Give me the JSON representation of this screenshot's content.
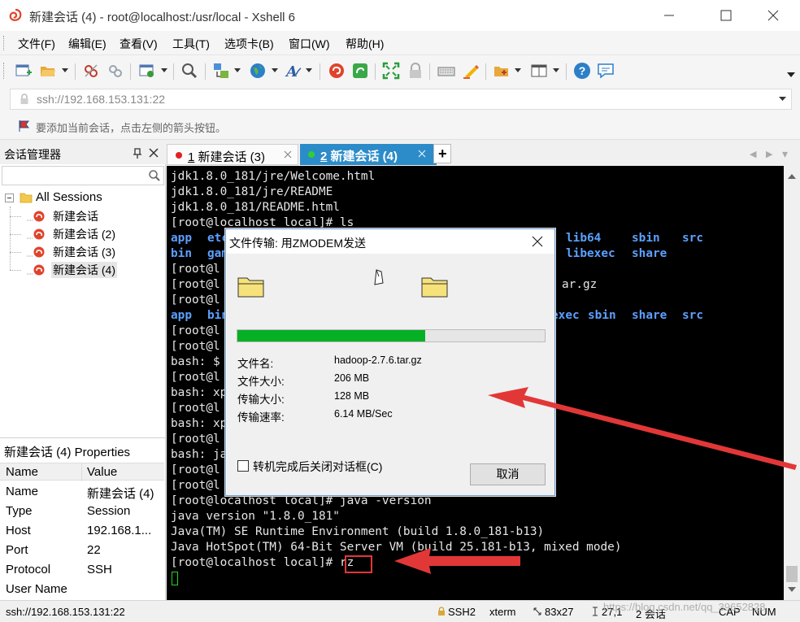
{
  "window": {
    "title": "新建会话 (4) - root@localhost:/usr/local - Xshell 6"
  },
  "menu": [
    "文件(F)",
    "编辑(E)",
    "查看(V)",
    "工具(T)",
    "选项卡(B)",
    "窗口(W)",
    "帮助(H)"
  ],
  "address": {
    "value": "ssh://192.168.153.131:22"
  },
  "hint": "要添加当前会话，点击左侧的箭头按钮。",
  "session_manager": {
    "title": "会话管理器",
    "root": "All Sessions",
    "items": [
      "新建会话",
      "新建会话 (2)",
      "新建会话 (3)",
      "新建会话 (4)"
    ],
    "selected_index": 3
  },
  "properties": {
    "title": "新建会话 (4) Properties",
    "col_name": "Name",
    "col_value": "Value",
    "rows": [
      {
        "k": "Name",
        "v": "新建会话 (4)"
      },
      {
        "k": "Type",
        "v": "Session"
      },
      {
        "k": "Host",
        "v": "192.168.1..."
      },
      {
        "k": "Port",
        "v": "22"
      },
      {
        "k": "Protocol",
        "v": "SSH"
      },
      {
        "k": "User Name",
        "v": ""
      }
    ]
  },
  "tabs": [
    {
      "num": "1",
      "label": " 新建会话 (3)",
      "dot_color": "#e02020"
    },
    {
      "num": "2",
      "label": " 新建会话 (4)",
      "dot_color": "#2fd12f"
    }
  ],
  "tab_add": "+",
  "terminal": {
    "lines": [
      "jdk1.8.0_181/jre/Welcome.html",
      "jdk1.8.0_181/jre/README",
      "jdk1.8.0_181/README.html",
      "[root@localhost local]# ls",
      "",
      "",
      "[root@l",
      "[root@l",
      "[root@l",
      "",
      "[root@l",
      "[root@l",
      "bash: $",
      "[root@l",
      "bash: xp",
      "[root@l",
      "bash: xp",
      "[root@l",
      "bash: ja",
      "[root@l",
      "[root@l",
      "[root@localhost local]# java -version",
      "java version \"1.8.0_181\"",
      "Java(TM) SE Runtime Environment (build 1.8.0_181-b13)",
      "Java HotSpot(TM) 64-Bit Server VM (build 25.181-b13, mixed mode)",
      "[root@localhost local]# rz"
    ],
    "ls_row1": {
      "left": "app",
      "left2": "etc",
      "right": [
        "lib64",
        "sbin",
        "src"
      ]
    },
    "ls_row2": {
      "left": "bin",
      "left2": "gam",
      "right": [
        "libexec",
        "share"
      ]
    },
    "tar_fragment": "ar.gz",
    "row10_left": [
      "app",
      "bin"
    ],
    "row10_right": [
      "exec",
      "sbin",
      "share",
      "src"
    ]
  },
  "dialog": {
    "title": "文件传输: 用ZMODEM发送",
    "progress_fraction": 0.61,
    "fields": [
      {
        "k": "文件名:",
        "v": "hadoop-2.7.6.tar.gz"
      },
      {
        "k": "文件大小:",
        "v": "206 MB"
      },
      {
        "k": "传输大小:",
        "v": "128 MB"
      },
      {
        "k": "传输速率:",
        "v": "6.14 MB/Sec"
      }
    ],
    "checkbox_label": "转机完成后关闭对话框(C)",
    "cancel": "取消"
  },
  "status": {
    "address": "ssh://192.168.153.131:22",
    "protocol": "SSH2",
    "term": "xterm",
    "size": "83x27",
    "cursor": "27,1",
    "sessions": "2 会话",
    "caps": "CAP",
    "num": "NUM",
    "watermark": "https://blog.csdn.net/qq_39652828"
  },
  "colors": {
    "tab_active": "#2c8cc9",
    "terminal_bg": "#000000",
    "dir_blue": "#5ca0ff",
    "progress_green": "#06b025",
    "annotation_red": "#e23737"
  }
}
